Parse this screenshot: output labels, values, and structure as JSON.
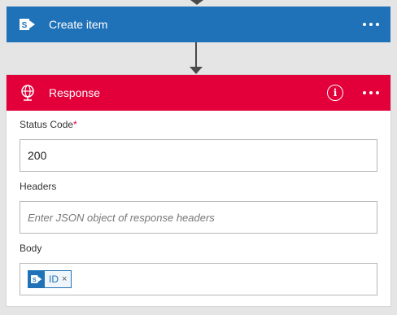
{
  "create_item": {
    "title": "Create item",
    "icon": "sharepoint-icon",
    "color": "#2072b8"
  },
  "response": {
    "title": "Response",
    "icon": "globe-network-icon",
    "color": "#e3003a",
    "info_icon": "i",
    "fields": {
      "status_code": {
        "label": "Status Code",
        "required_mark": "*",
        "value": "200"
      },
      "headers": {
        "label": "Headers",
        "value": "",
        "placeholder": "Enter JSON object of response headers"
      },
      "body": {
        "label": "Body",
        "token": {
          "label": "ID",
          "icon": "sharepoint-icon",
          "remove": "×"
        }
      }
    }
  }
}
